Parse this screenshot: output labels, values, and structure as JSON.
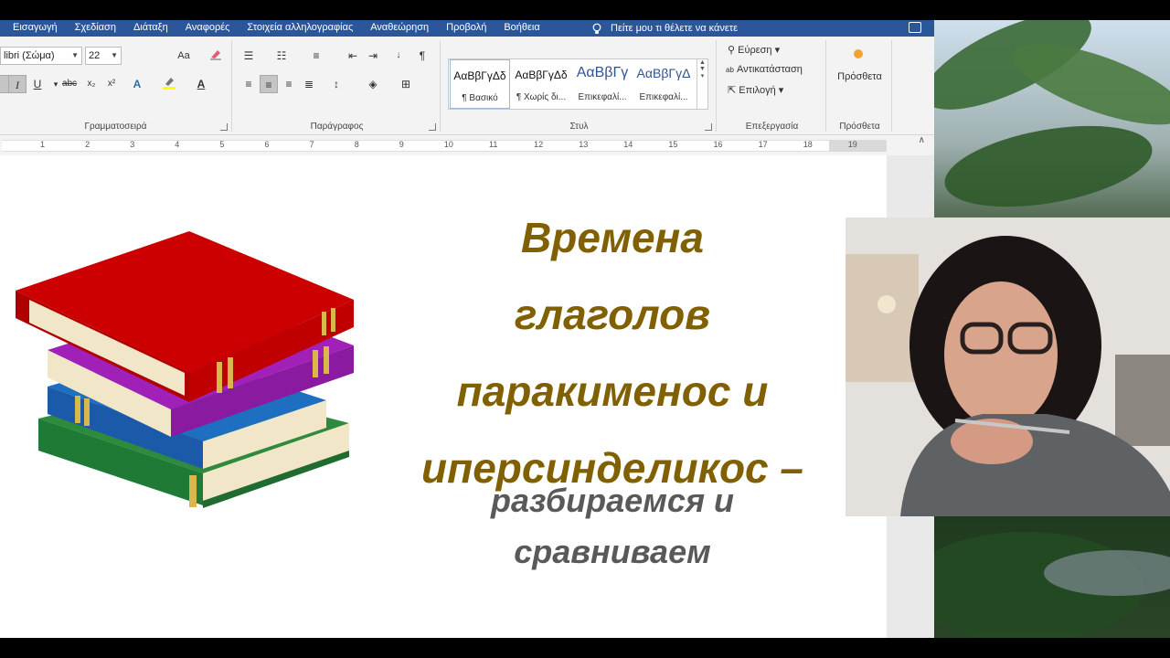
{
  "menu": {
    "tabs": [
      "Εισαγωγή",
      "Σχεδίαση",
      "Διάταξη",
      "Αναφορές",
      "Στοιχεία αλληλογραφίας",
      "Αναθεώρηση",
      "Προβολή",
      "Βοήθεια"
    ],
    "tell_me": "Πείτε μου τι θέλετε να κάνετε"
  },
  "ribbon": {
    "font": {
      "name": "libri (Σώμα)",
      "size": "22",
      "label": "Γραμματοσειρά",
      "aa": "Aa"
    },
    "paragraph": {
      "label": "Παράγραφος"
    },
    "styles": {
      "label": "Στυλ",
      "items": [
        {
          "sample": "ΑαΒβΓγΔδ",
          "name": "¶ Βασικό"
        },
        {
          "sample": "ΑαΒβΓγΔδ",
          "name": "¶ Χωρίς δι..."
        },
        {
          "sample": "ΑαΒβΓγ",
          "name": "Επικεφαλί..."
        },
        {
          "sample": "ΑαΒβΓγΔ",
          "name": "Επικεφαλί..."
        }
      ]
    },
    "editing": {
      "label": "Επεξεργασία",
      "find": "Εύρεση",
      "replace": "Αντικατάσταση",
      "select": "Επιλογή"
    },
    "addins": {
      "label": "Πρόσθετα",
      "button": "Πρόσθετα"
    }
  },
  "ruler": {
    "numbers": [
      "1",
      "2",
      "3",
      "4",
      "5",
      "6",
      "7",
      "8",
      "9",
      "10",
      "11",
      "12",
      "13",
      "14",
      "15",
      "16",
      "17",
      "18",
      "19"
    ]
  },
  "document": {
    "title_lines": [
      "Времена",
      "глаголов",
      "паракименос и",
      "иперсинделикос –"
    ],
    "subtitle_lines": [
      "разбираемся и",
      "сравниваем"
    ]
  },
  "colors": {
    "title": "#806000",
    "subtitle": "#595959",
    "accent": "#2b579a"
  }
}
